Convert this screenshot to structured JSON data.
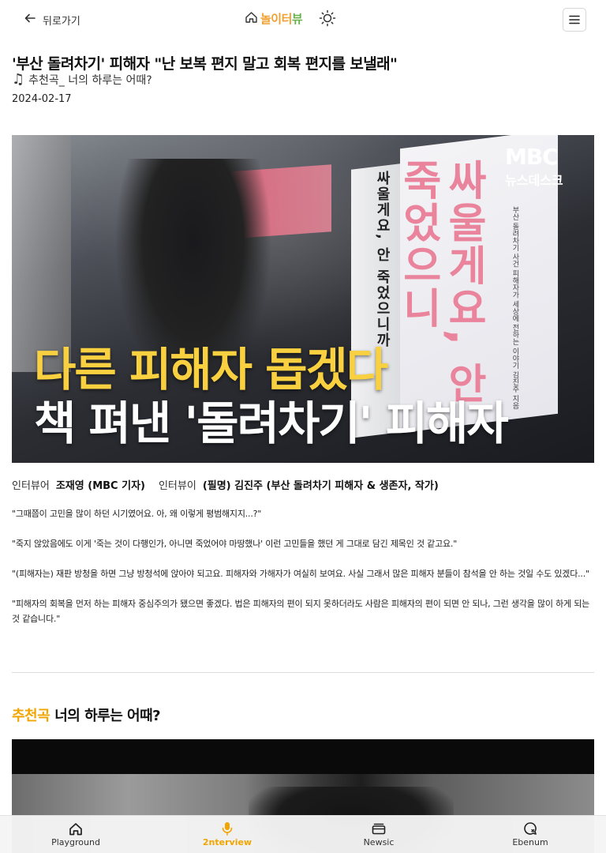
{
  "header": {
    "back_label": "뒤로가기",
    "logo_text_a": "놀이터",
    "logo_text_b": "뷰"
  },
  "article": {
    "title": "'부산 돌려차기' 피해자 \"난 보복 편지 말고 회복 편지를 보낼래\"",
    "subtitle": "추천곡_ 너의 하루는 어때?",
    "date": "2024-02-17"
  },
  "hero": {
    "channel_logo": "MBC",
    "channel_sub": "뉴스데스크",
    "book_spine": "싸울게요, 안 죽었으니까",
    "book_title": "싸울게요, 안 죽었으니",
    "book_small": "부산 돌려차기 사건 피해자가 세상에 전하는 이야기 김진주 지음",
    "caption_line1": "다른 피해자 돕겠다",
    "caption_line2": "책 펴낸 '돌려차기' 피해자"
  },
  "credits": {
    "interviewer_label": "인터뷰어",
    "interviewer_name": "조재영 (MBC 기자)",
    "interviewee_label": "인터뷰이",
    "interviewee_name": "(필명) 김진주 (부산 돌려차기 피해자 & 생존자, 작가)"
  },
  "quotes": [
    "\"그때쯤이 고민을 많이 하던 시기였어요. 아, 왜 이렇게 평범해지지...?\"",
    "\"죽지 않았음에도 이게 '죽는 것이 다행인가, 아니면 죽었어야 마땅했나' 이런 고민들을 했던 게 그대로 담긴 제목인 것 같고요.\"",
    "\"(피해자는) 재판 방청을 하면 그냥 방청석에 앉아야 되고요. 피해자와 가해자가 여실히 보여요. 사실 그래서 많은 피해자 분들이 참석을 안 하는 것일 수도 있겠다...\"",
    "\"피해자의 회복을 먼저 하는 피해자 중심주의가 됐으면 좋겠다. 법은 피해자의 편이 되지 못하더라도 사람은 피해자의 편이 되면 안 되나, 그런 생각을 많이 하게 되는 것 같습니다.\""
  ],
  "recommend": {
    "accent": "추천곡",
    "title": "너의 하루는 어때?"
  },
  "nav": [
    {
      "label": "Playground",
      "icon": "home-icon"
    },
    {
      "label": "2nterview",
      "icon": "microphone-icon"
    },
    {
      "label": "Newsic",
      "icon": "news-icon"
    },
    {
      "label": "Ebenum",
      "icon": "chat-search-icon"
    }
  ],
  "colors": {
    "accent": "#f0a500",
    "logo_orange": "#f0a030",
    "logo_green": "#6ab04c",
    "caption_yellow": "#f8d040"
  }
}
